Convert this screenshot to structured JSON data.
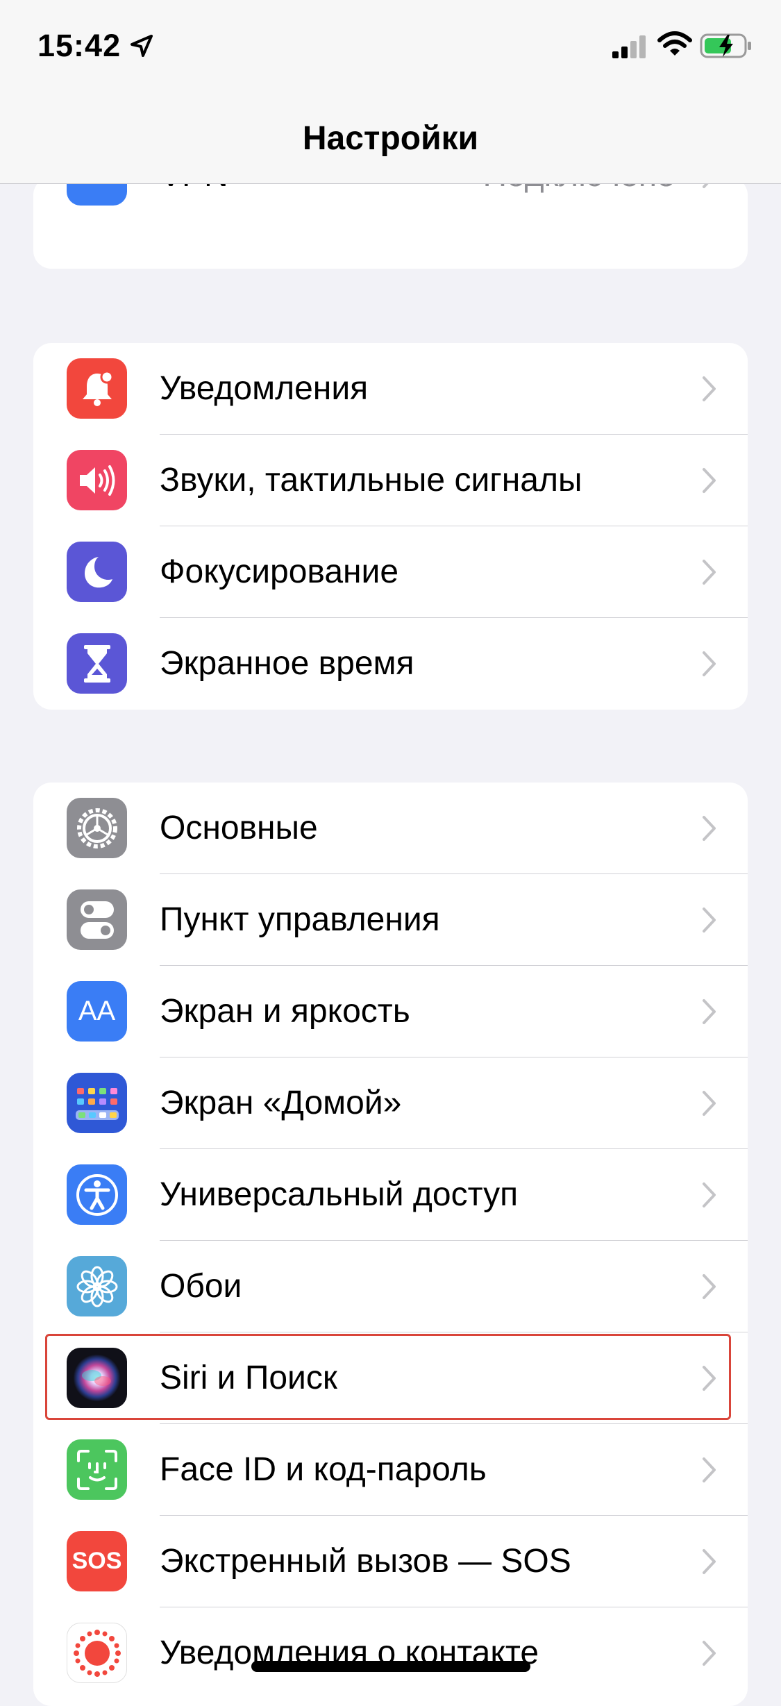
{
  "status_bar": {
    "time": "15:42"
  },
  "nav": {
    "title": "Настройки"
  },
  "vpn_group": [
    {
      "label": "VPN",
      "value": "Подключено",
      "icon": "vpn-icon",
      "icon_text": "VPN",
      "color": "#3a7df5"
    }
  ],
  "notif_group": [
    {
      "label": "Уведомления",
      "icon": "bell-icon",
      "color": "#f2473d"
    },
    {
      "label": "Звуки, тактильные сигналы",
      "icon": "speaker-icon",
      "color": "#f04563"
    },
    {
      "label": "Фокусирование",
      "icon": "moon-icon",
      "color": "#5b56d6"
    },
    {
      "label": "Экранное время",
      "icon": "hourglass-icon",
      "color": "#5b56d6"
    }
  ],
  "general_group": [
    {
      "label": "Основные",
      "icon": "gear-icon",
      "color": "#8e8e93"
    },
    {
      "label": "Пункт управления",
      "icon": "toggles-icon",
      "color": "#8e8e93"
    },
    {
      "label": "Экран и яркость",
      "icon": "text-size-icon",
      "icon_text": "AA",
      "color": "#3a7df5"
    },
    {
      "label": "Экран «Домой»",
      "icon": "home-grid-icon",
      "color": "#2f58d6"
    },
    {
      "label": "Универсальный доступ",
      "icon": "accessibility-icon",
      "color": "#3a7df5"
    },
    {
      "label": "Обои",
      "icon": "flower-icon",
      "color": "#56a9d9"
    },
    {
      "label": "Siri и Поиск",
      "icon": "siri-icon",
      "color": "#1b1b2e"
    },
    {
      "label": "Face ID и код-пароль",
      "icon": "face-id-icon",
      "color": "#4cc65e"
    },
    {
      "label": "Экстренный вызов — SOS",
      "icon": "sos-icon",
      "icon_text": "SOS",
      "color": "#f2473d"
    },
    {
      "label": "Уведомления о контакте",
      "icon": "exposure-icon",
      "color": "#ffffff"
    }
  ]
}
